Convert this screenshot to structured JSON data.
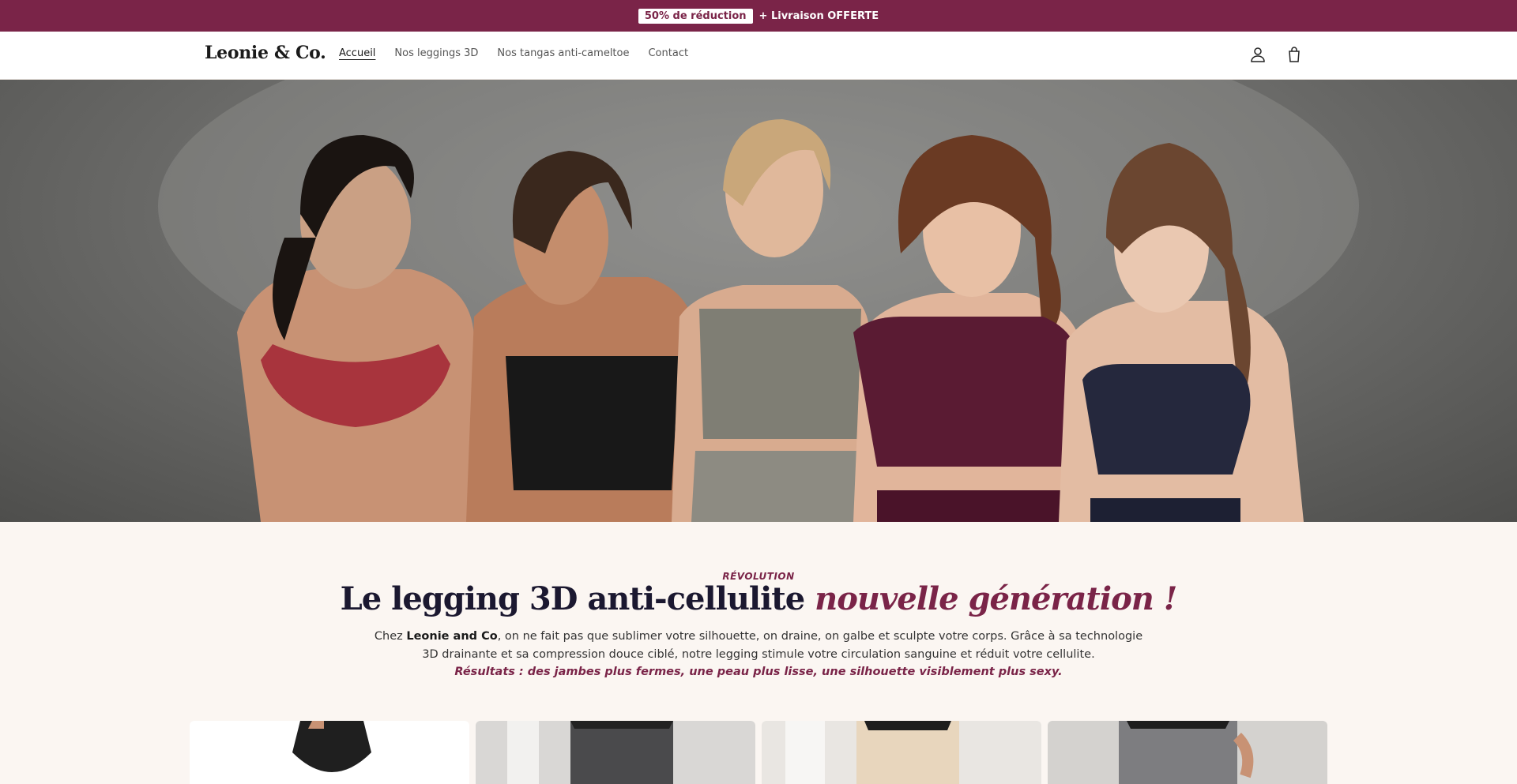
{
  "announcement": {
    "badge": "50% de réduction",
    "text": "+ Livraison OFFERTE"
  },
  "header": {
    "logo": "Leonie & Co.",
    "nav": [
      "Accueil",
      "Nos leggings 3D",
      "Nos tangas anti-cameltoe",
      "Contact"
    ],
    "active_nav": "Accueil",
    "icons": [
      "account-icon",
      "cart-icon"
    ]
  },
  "section": {
    "eyebrow": "RÉVOLUTION",
    "headline_main": "Le legging 3D anti-cellulite",
    "headline_accent": "nouvelle génération !",
    "desc_prefix": "Chez ",
    "desc_brand": "Leonie and Co",
    "desc_body": ", on ne fait pas que sublimer votre silhouette, on draine, on galbe et sculpte votre corps. Grâce à sa technologie 3D drainante et sa compression douce ciblé, notre legging stimule votre circulation sanguine et réduit votre cellulite.",
    "desc_result": "Résultats : des jambes plus fermes, une peau plus lisse, une silhouette visiblement plus sexy."
  },
  "colors": {
    "brand": "#7a2448",
    "ink": "#1b1830",
    "cream": "#fbf6f2"
  }
}
